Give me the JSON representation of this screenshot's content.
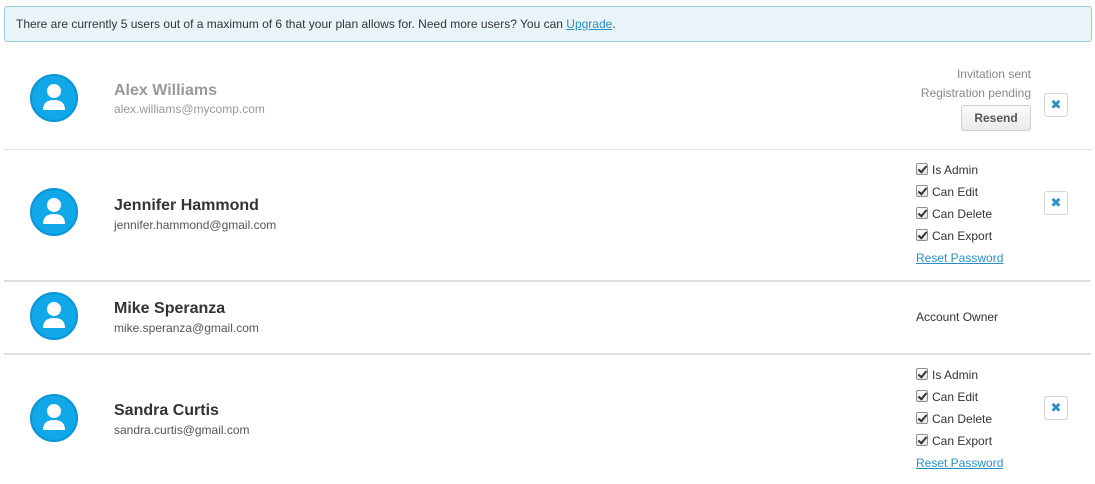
{
  "notice": {
    "text": "There are currently 5 users out of a maximum of 6 that your plan allows for. Need more users? You can ",
    "link": "Upgrade",
    "suffix": "."
  },
  "users": [
    {
      "name": "Alex Williams",
      "email": "alex.williams@mycomp.com",
      "status_line1": "Invitation sent",
      "status_line2": "Registration pending",
      "resend_label": "Resend",
      "remove_icon": "✖"
    },
    {
      "name": "Jennifer Hammond",
      "email": "jennifer.hammond@gmail.com",
      "permissions": [
        "Is Admin",
        "Can Edit",
        "Can Delete",
        "Can Export"
      ],
      "reset_label": "Reset Password",
      "remove_icon": "✖"
    },
    {
      "name": "Mike Speranza",
      "email": "mike.speranza@gmail.com",
      "role": "Account Owner"
    },
    {
      "name": "Sandra Curtis",
      "email": "sandra.curtis@gmail.com",
      "permissions": [
        "Is Admin",
        "Can Edit",
        "Can Delete",
        "Can Export"
      ],
      "reset_label": "Reset Password",
      "remove_icon": "✖"
    }
  ],
  "colors": {
    "accent": "#2a8fc7",
    "avatar": "#10a8e8",
    "notice_bg": "#e9f4f9"
  }
}
